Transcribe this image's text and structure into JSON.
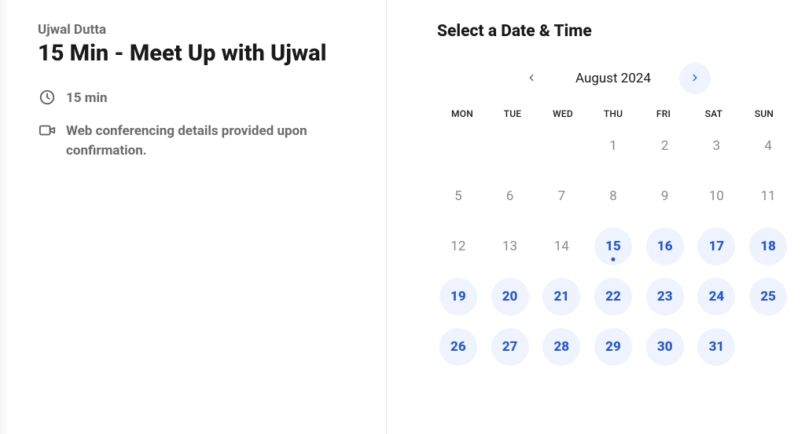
{
  "left": {
    "host": "Ujwal Dutta",
    "title": "15 Min - Meet Up with Ujwal",
    "duration": "15 min",
    "location_note": "Web conferencing details provided upon confirmation."
  },
  "right": {
    "heading": "Select a Date & Time",
    "month_label": "August 2024",
    "weekdays": [
      "MON",
      "TUE",
      "WED",
      "THU",
      "FRI",
      "SAT",
      "SUN"
    ],
    "days": [
      {
        "n": "",
        "t": "blank"
      },
      {
        "n": "",
        "t": "blank"
      },
      {
        "n": "",
        "t": "blank"
      },
      {
        "n": "1",
        "t": "disabled"
      },
      {
        "n": "2",
        "t": "disabled"
      },
      {
        "n": "3",
        "t": "disabled"
      },
      {
        "n": "4",
        "t": "disabled"
      },
      {
        "n": "5",
        "t": "disabled"
      },
      {
        "n": "6",
        "t": "disabled"
      },
      {
        "n": "7",
        "t": "disabled"
      },
      {
        "n": "8",
        "t": "disabled"
      },
      {
        "n": "9",
        "t": "disabled"
      },
      {
        "n": "10",
        "t": "disabled"
      },
      {
        "n": "11",
        "t": "disabled"
      },
      {
        "n": "12",
        "t": "disabled"
      },
      {
        "n": "13",
        "t": "disabled"
      },
      {
        "n": "14",
        "t": "disabled"
      },
      {
        "n": "15",
        "t": "available",
        "today": true
      },
      {
        "n": "16",
        "t": "available"
      },
      {
        "n": "17",
        "t": "available"
      },
      {
        "n": "18",
        "t": "available"
      },
      {
        "n": "19",
        "t": "available"
      },
      {
        "n": "20",
        "t": "available"
      },
      {
        "n": "21",
        "t": "available"
      },
      {
        "n": "22",
        "t": "available"
      },
      {
        "n": "23",
        "t": "available"
      },
      {
        "n": "24",
        "t": "available"
      },
      {
        "n": "25",
        "t": "available"
      },
      {
        "n": "26",
        "t": "available"
      },
      {
        "n": "27",
        "t": "available"
      },
      {
        "n": "28",
        "t": "available"
      },
      {
        "n": "29",
        "t": "available"
      },
      {
        "n": "30",
        "t": "available"
      },
      {
        "n": "31",
        "t": "available"
      }
    ]
  }
}
